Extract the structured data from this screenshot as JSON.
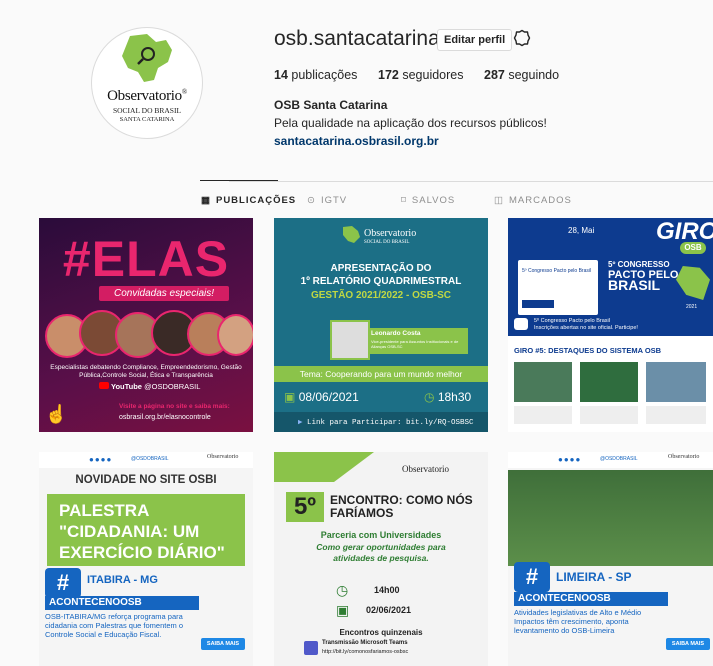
{
  "profile": {
    "logo": {
      "main": "Observatorio",
      "sub": "SOCIAL DO BRASIL",
      "sub2": "SANTA CATARINA",
      "reg": "®"
    },
    "username": "osb.santacatarina",
    "edit_label": "Editar perfil",
    "posts_count": "14",
    "posts_label": "publicações",
    "followers_count": "172",
    "followers_label": "seguidores",
    "following_count": "287",
    "following_label": "seguindo",
    "full_name": "OSB Santa Catarina",
    "bio": "Pela qualidade na aplicação dos recursos públicos!",
    "website": "santacatarina.osbrasil.org.br"
  },
  "tabs": [
    {
      "label": "PUBLICAÇÕES",
      "icon": "grid-icon"
    },
    {
      "label": "IGTV",
      "icon": "igtv-icon"
    },
    {
      "label": "SALVOS",
      "icon": "bookmark-icon"
    },
    {
      "label": "MARCADOS",
      "icon": "tagged-icon"
    }
  ],
  "posts": {
    "elas": {
      "hashtag": "#ELAS",
      "subtitle": "Convidadas especiais!",
      "desc": "Especialistas debatendo Compliance, Empreendedorismo, Gestão Pública,Controle Social, Ética e Transparência",
      "youtube": "YouTube",
      "youtube_handle": "@OSDOBRASIL",
      "cta": "Visite a página no site e saiba mais:",
      "url": "osbrasil.org.br/elasnocontrole"
    },
    "relatorio": {
      "line1": "APRESENTAÇÃO DO",
      "line2": "1º RELATÓRIO QUADRIMESTRAL",
      "line3": "GESTÃO 2021/2022 - OSB-SC",
      "speaker": "Leonardo Costa",
      "speaker_role": "Vice-presidente para Assuntos Institucionais e de Alianças OSB-SC",
      "theme": "Tema: Cooperando para um mundo melhor",
      "date": "08/06/2021",
      "time": "18h30",
      "link": "Link para Participar: bit.ly/RQ-OSBSC"
    },
    "giro": {
      "date": "28, Mai",
      "giro": "GIRO",
      "osb": "OSB",
      "congress_small": "5º Congresso Pacto pelo Brasil",
      "congress_title_1": "5º CONGRESSO",
      "congress_title_2": "PACTO PELO",
      "congress_title_3": "BRASIL",
      "year": "2021",
      "caption_1": "5º Congresso Pacto pelo Brasil",
      "caption_2": "Inscrições abertas no site oficial. Participe!",
      "headline": "GIRO #5: DESTAQUES DO SISTEMA OSB"
    },
    "palestra": {
      "handle": "@OSDOBRASIL",
      "novidade": "NOVIDADE NO SITE OSBI",
      "title": "PALESTRA \"CIDADANIA: UM EXERCÍCIO DIÁRIO\"",
      "city": "ITABIRA - MG",
      "tag": "ACONTECENOOSB",
      "body": "OSB-ITABIRA/MG reforça programa para cidadania com Palestras que fomentem o Controle Social e Educação Fiscal.",
      "saiba": "SAIBA MAIS"
    },
    "encontro": {
      "num": "5º",
      "title": "ENCONTRO: COMO NÓS FARÍAMOS",
      "sub1": "Parceria com Universidades",
      "sub2": "Como gerar oportunidades para atividades de pesquisa.",
      "time": "14h00",
      "date": "02/06/2021",
      "quinzenais": "Encontros quinzenais",
      "teams": "Transmissão Microsoft Teams",
      "teams_link": "http://bit.ly/comonosfariamos-osbsc"
    },
    "limeira": {
      "handle": "@OSDOBRASIL",
      "city": "LIMEIRA - SP",
      "tag": "ACONTECENOOSB",
      "body": "Atividades legislativas de Alto e Médio Impactos têm crescimento, aponta levantamento do OSB-Limeira",
      "saiba": "SAIBA MAIS"
    }
  },
  "colors": {
    "accent": "#00376b",
    "green": "#8bc34a",
    "blue": "#1565c0",
    "teal": "#1c6f86"
  }
}
